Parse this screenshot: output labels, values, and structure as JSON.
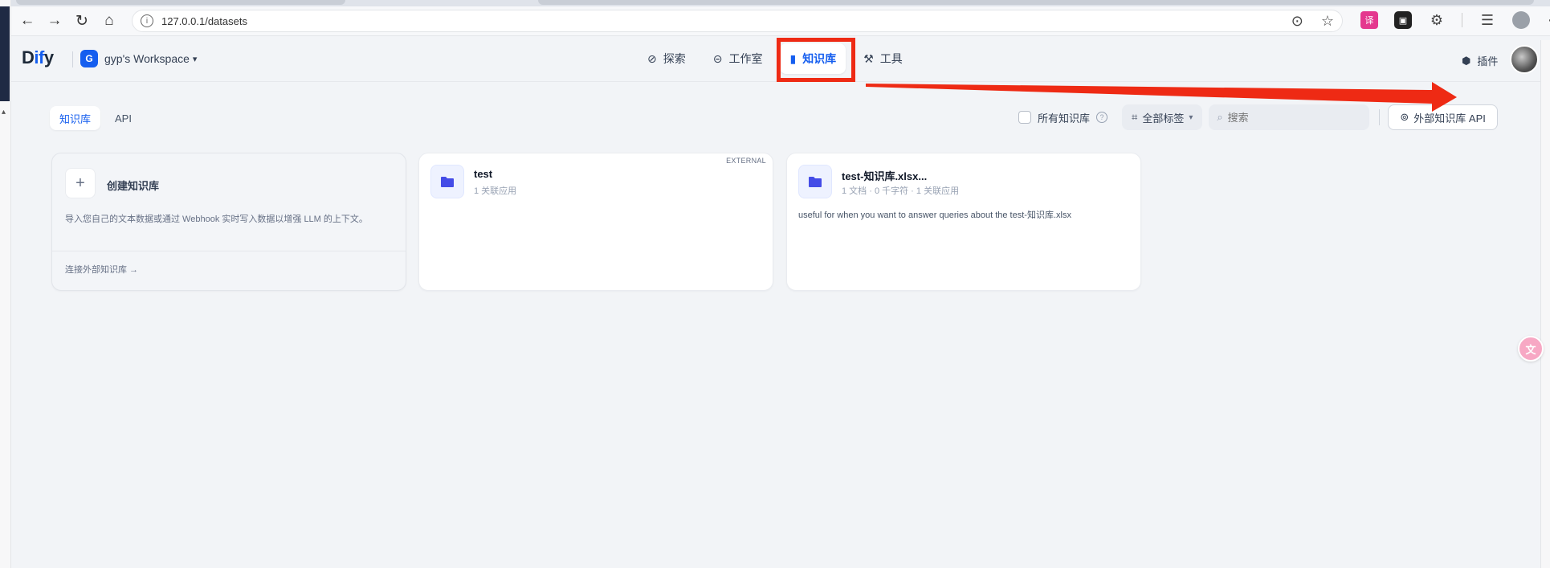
{
  "browser": {
    "url": "127.0.0.1/datasets"
  },
  "app": {
    "logo_prefix": "D",
    "logo_mid": "if",
    "logo_suffix": "y",
    "workspace_badge": "G",
    "workspace_name": "gyp's Workspace",
    "nav": [
      {
        "label": "探索",
        "icon": "explore-icon"
      },
      {
        "label": "工作室",
        "icon": "studio-icon"
      },
      {
        "label": "知识库",
        "icon": "knowledge-icon",
        "active": true
      },
      {
        "label": "工具",
        "icon": "tools-icon"
      }
    ],
    "plugin_label": "插件"
  },
  "toolbar": {
    "tabs": [
      "知识库",
      "API"
    ],
    "all_knowledge_label": "所有知识库",
    "tag_filter_label": "全部标签",
    "search_placeholder": "搜索",
    "external_api_label": "外部知识库 API"
  },
  "create_card": {
    "title": "创建知识库",
    "description": "导入您自己的文本数据或通过 Webhook 实时写入数据以增强 LLM 的上下文。",
    "link": "连接外部知识库 →"
  },
  "datasets": [
    {
      "name": "test",
      "meta": "1 关联应用",
      "description": "",
      "tag": "EXTERNAL"
    },
    {
      "name": "test-知识库.xlsx...",
      "meta": "1 文档 · 0 千字符 · 1 关联应用",
      "description": "useful for when you want to answer queries about the test-知识库.xlsx",
      "tag": ""
    }
  ],
  "colors": {
    "accent": "#155eef",
    "annotation": "#ee2a14",
    "background": "#f2f4f7"
  }
}
